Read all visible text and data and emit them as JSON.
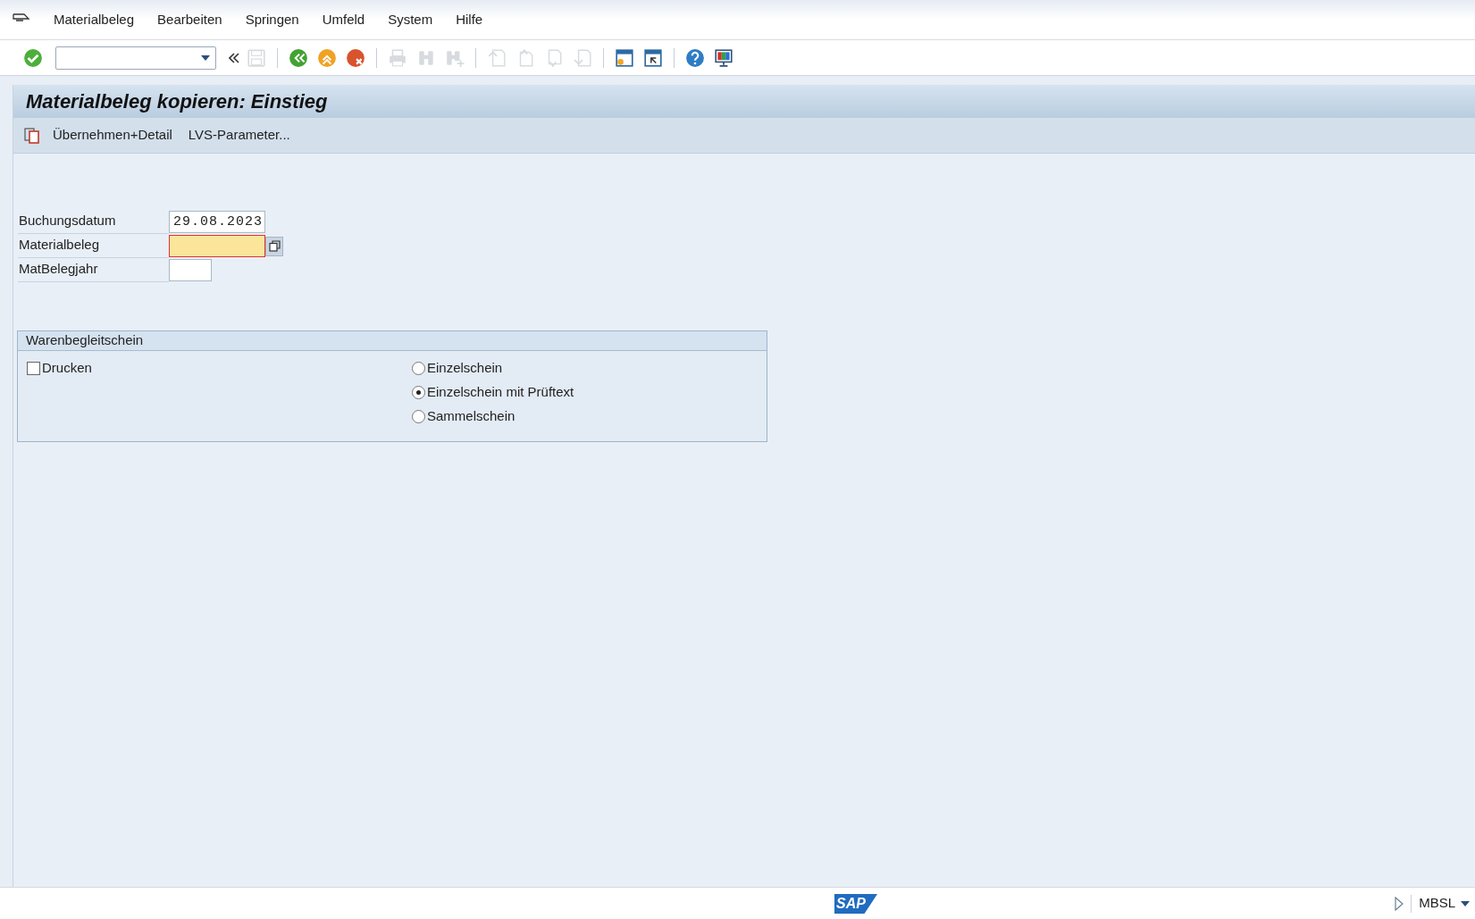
{
  "menu": [
    {
      "label": "Materialbeleg"
    },
    {
      "label": "Bearbeiten"
    },
    {
      "label": "Springen"
    },
    {
      "label": "Umfeld"
    },
    {
      "label": "System"
    },
    {
      "label": "Hilfe"
    }
  ],
  "toolbar": {
    "buttons": [
      {
        "disabled": false
      },
      {
        "disabled": true
      },
      {
        "disabled": false
      },
      {
        "disabled": false
      },
      {
        "disabled": false
      },
      {
        "disabled": true
      },
      {
        "disabled": true
      },
      {
        "disabled": true
      },
      {
        "disabled": true
      },
      {
        "disabled": true
      },
      {
        "disabled": true
      },
      {
        "disabled": true
      },
      {
        "disabled": false
      },
      {
        "disabled": false
      },
      {
        "disabled": false
      },
      {
        "disabled": false
      }
    ]
  },
  "title": "Materialbeleg kopieren: Einstieg",
  "app_toolbar": [
    {
      "label": "Übernehmen+Detail",
      "icon": true
    },
    {
      "label": "LVS-Parameter...",
      "icon": false
    }
  ],
  "fields": [
    {
      "label": "Buchungsdatum",
      "value": "29.08.2023",
      "focused": false,
      "value_help": false
    },
    {
      "label": "Materialbeleg",
      "focused": true,
      "value_help": true
    },
    {
      "label": "MatBelegjahr",
      "focused": false,
      "value_help": false
    }
  ],
  "group": {
    "title": "Warenbegleitschein",
    "checkbox": {
      "label": "Drucken",
      "checked": false
    },
    "radios": [
      {
        "label": "Einzelschein",
        "selected": false
      },
      {
        "label": "Einzelschein mit Prüftext",
        "selected": true
      },
      {
        "label": "Sammelschein",
        "selected": false
      }
    ]
  },
  "status_bar": {
    "logo": "SAP",
    "system": "MBSL"
  }
}
